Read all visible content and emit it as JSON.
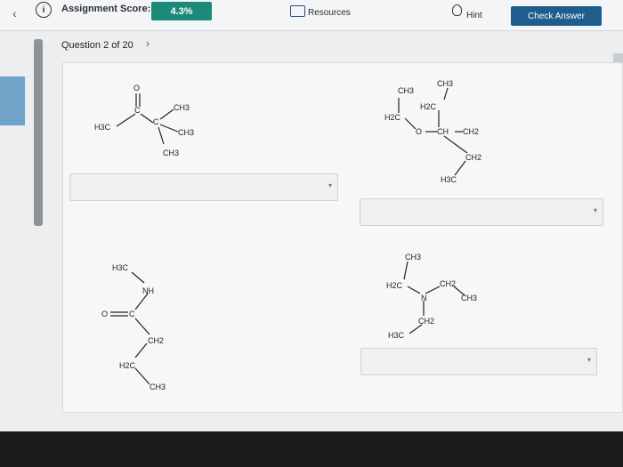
{
  "toolbar": {
    "assignment_score_label": "Assignment Score:",
    "score": "4.3%",
    "resources_label": "Resources",
    "hint_label": "Hint",
    "check_answer_label": "Check Answer"
  },
  "navigation": {
    "question_label": "Question 2 of 20"
  },
  "molecules": {
    "m1": {
      "a1": "O",
      "a2": "C",
      "a3": "H3C",
      "a4": "C",
      "a5": "CH3",
      "a6": "CH3",
      "a7": "CH3"
    },
    "m2": {
      "a1": "CH3",
      "a2": "CH3",
      "a3": "H2C",
      "a4": "H2C",
      "a5": "O",
      "a6": "CH",
      "a7": "CH2",
      "a8": "CH2",
      "a9": "H3C"
    },
    "m3": {
      "a1": "H3C",
      "a2": "NH",
      "a3": "O",
      "a4": "C",
      "a5": "CH2",
      "a6": "H2C",
      "a7": "CH3"
    },
    "m4": {
      "a1": "CH3",
      "a2": "H2C",
      "a3": "N",
      "a4": "CH2",
      "a5": "CH3",
      "a6": "CH2",
      "a7": "H3C"
    }
  },
  "answers": [
    {
      "selected": ""
    },
    {
      "selected": ""
    },
    {
      "selected": ""
    },
    {
      "selected": ""
    }
  ],
  "colors": {
    "score_badge": "#1c8a78",
    "check_button": "#1e5d8c"
  }
}
